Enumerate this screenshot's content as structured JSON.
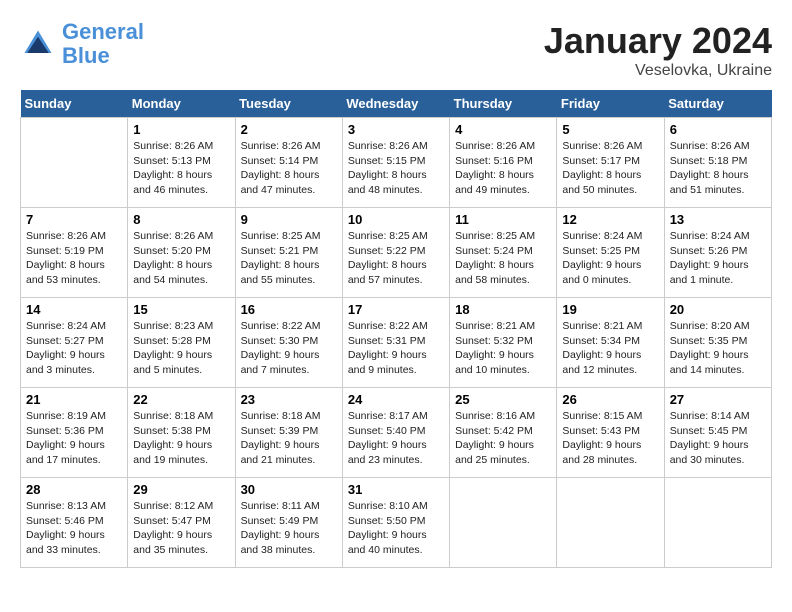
{
  "header": {
    "logo_line1": "General",
    "logo_line2": "Blue",
    "month": "January 2024",
    "location": "Veselovka, Ukraine"
  },
  "days_of_week": [
    "Sunday",
    "Monday",
    "Tuesday",
    "Wednesday",
    "Thursday",
    "Friday",
    "Saturday"
  ],
  "weeks": [
    [
      {
        "day": "",
        "info": ""
      },
      {
        "day": "1",
        "info": "Sunrise: 8:26 AM\nSunset: 5:13 PM\nDaylight: 8 hours\nand 46 minutes."
      },
      {
        "day": "2",
        "info": "Sunrise: 8:26 AM\nSunset: 5:14 PM\nDaylight: 8 hours\nand 47 minutes."
      },
      {
        "day": "3",
        "info": "Sunrise: 8:26 AM\nSunset: 5:15 PM\nDaylight: 8 hours\nand 48 minutes."
      },
      {
        "day": "4",
        "info": "Sunrise: 8:26 AM\nSunset: 5:16 PM\nDaylight: 8 hours\nand 49 minutes."
      },
      {
        "day": "5",
        "info": "Sunrise: 8:26 AM\nSunset: 5:17 PM\nDaylight: 8 hours\nand 50 minutes."
      },
      {
        "day": "6",
        "info": "Sunrise: 8:26 AM\nSunset: 5:18 PM\nDaylight: 8 hours\nand 51 minutes."
      }
    ],
    [
      {
        "day": "7",
        "info": "Sunrise: 8:26 AM\nSunset: 5:19 PM\nDaylight: 8 hours\nand 53 minutes."
      },
      {
        "day": "8",
        "info": "Sunrise: 8:26 AM\nSunset: 5:20 PM\nDaylight: 8 hours\nand 54 minutes."
      },
      {
        "day": "9",
        "info": "Sunrise: 8:25 AM\nSunset: 5:21 PM\nDaylight: 8 hours\nand 55 minutes."
      },
      {
        "day": "10",
        "info": "Sunrise: 8:25 AM\nSunset: 5:22 PM\nDaylight: 8 hours\nand 57 minutes."
      },
      {
        "day": "11",
        "info": "Sunrise: 8:25 AM\nSunset: 5:24 PM\nDaylight: 8 hours\nand 58 minutes."
      },
      {
        "day": "12",
        "info": "Sunrise: 8:24 AM\nSunset: 5:25 PM\nDaylight: 9 hours\nand 0 minutes."
      },
      {
        "day": "13",
        "info": "Sunrise: 8:24 AM\nSunset: 5:26 PM\nDaylight: 9 hours\nand 1 minute."
      }
    ],
    [
      {
        "day": "14",
        "info": "Sunrise: 8:24 AM\nSunset: 5:27 PM\nDaylight: 9 hours\nand 3 minutes."
      },
      {
        "day": "15",
        "info": "Sunrise: 8:23 AM\nSunset: 5:28 PM\nDaylight: 9 hours\nand 5 minutes."
      },
      {
        "day": "16",
        "info": "Sunrise: 8:22 AM\nSunset: 5:30 PM\nDaylight: 9 hours\nand 7 minutes."
      },
      {
        "day": "17",
        "info": "Sunrise: 8:22 AM\nSunset: 5:31 PM\nDaylight: 9 hours\nand 9 minutes."
      },
      {
        "day": "18",
        "info": "Sunrise: 8:21 AM\nSunset: 5:32 PM\nDaylight: 9 hours\nand 10 minutes."
      },
      {
        "day": "19",
        "info": "Sunrise: 8:21 AM\nSunset: 5:34 PM\nDaylight: 9 hours\nand 12 minutes."
      },
      {
        "day": "20",
        "info": "Sunrise: 8:20 AM\nSunset: 5:35 PM\nDaylight: 9 hours\nand 14 minutes."
      }
    ],
    [
      {
        "day": "21",
        "info": "Sunrise: 8:19 AM\nSunset: 5:36 PM\nDaylight: 9 hours\nand 17 minutes."
      },
      {
        "day": "22",
        "info": "Sunrise: 8:18 AM\nSunset: 5:38 PM\nDaylight: 9 hours\nand 19 minutes."
      },
      {
        "day": "23",
        "info": "Sunrise: 8:18 AM\nSunset: 5:39 PM\nDaylight: 9 hours\nand 21 minutes."
      },
      {
        "day": "24",
        "info": "Sunrise: 8:17 AM\nSunset: 5:40 PM\nDaylight: 9 hours\nand 23 minutes."
      },
      {
        "day": "25",
        "info": "Sunrise: 8:16 AM\nSunset: 5:42 PM\nDaylight: 9 hours\nand 25 minutes."
      },
      {
        "day": "26",
        "info": "Sunrise: 8:15 AM\nSunset: 5:43 PM\nDaylight: 9 hours\nand 28 minutes."
      },
      {
        "day": "27",
        "info": "Sunrise: 8:14 AM\nSunset: 5:45 PM\nDaylight: 9 hours\nand 30 minutes."
      }
    ],
    [
      {
        "day": "28",
        "info": "Sunrise: 8:13 AM\nSunset: 5:46 PM\nDaylight: 9 hours\nand 33 minutes."
      },
      {
        "day": "29",
        "info": "Sunrise: 8:12 AM\nSunset: 5:47 PM\nDaylight: 9 hours\nand 35 minutes."
      },
      {
        "day": "30",
        "info": "Sunrise: 8:11 AM\nSunset: 5:49 PM\nDaylight: 9 hours\nand 38 minutes."
      },
      {
        "day": "31",
        "info": "Sunrise: 8:10 AM\nSunset: 5:50 PM\nDaylight: 9 hours\nand 40 minutes."
      },
      {
        "day": "",
        "info": ""
      },
      {
        "day": "",
        "info": ""
      },
      {
        "day": "",
        "info": ""
      }
    ]
  ]
}
